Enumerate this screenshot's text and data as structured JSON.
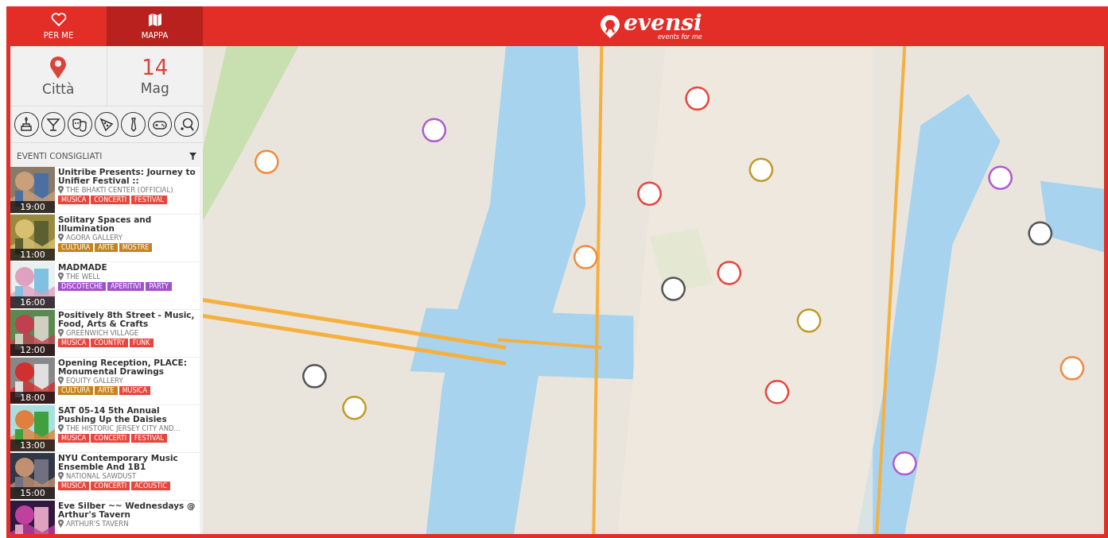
{
  "tabs": [
    {
      "label": "PER ME",
      "kind": "heart",
      "selected": false
    },
    {
      "label": "MAPPA",
      "kind": "map",
      "selected": true
    }
  ],
  "logo": {
    "name": "evensi",
    "tagline": "events for me"
  },
  "location": {
    "label": "Città"
  },
  "date": {
    "day": "14",
    "month": "Mag"
  },
  "categories": [
    {
      "kind": "cake"
    },
    {
      "kind": "cocktail"
    },
    {
      "kind": "masks"
    },
    {
      "kind": "pizza"
    },
    {
      "kind": "tie"
    },
    {
      "kind": "gamepad"
    },
    {
      "kind": "paddle"
    }
  ],
  "section": {
    "title": "EVENTI CONSIGLIATI"
  },
  "events": [
    {
      "title": "Unitribe Presents: Journey to Unifier Festival ::",
      "venue": "THE BHAKTI CENTER (OFFICIAL)",
      "time": "19:00",
      "tags": [
        {
          "label": "MUSICA",
          "color": "#e8453c"
        },
        {
          "label": "CONCERTI",
          "color": "#e8453c"
        },
        {
          "label": "FESTIVAL",
          "color": "#e8453c"
        }
      ]
    },
    {
      "title": "Solitary Spaces and Illumination",
      "venue": "AGORA GALLERY",
      "time": "11:00",
      "tags": [
        {
          "label": "CULTURA",
          "color": "#c8821c"
        },
        {
          "label": "ARTE",
          "color": "#c8821c"
        },
        {
          "label": "MOSTRE",
          "color": "#c8821c"
        }
      ]
    },
    {
      "title": "MADMADE",
      "venue": "THE WELL",
      "time": "16:00",
      "tags": [
        {
          "label": "DISCOTECHE",
          "color": "#a24fcc"
        },
        {
          "label": "APERITIVI",
          "color": "#a24fcc"
        },
        {
          "label": "PARTY",
          "color": "#a24fcc"
        }
      ]
    },
    {
      "title": "Positively 8th Street - Music, Food, Arts & Crafts",
      "venue": "GREENWICH VILLAGE",
      "time": "12:00",
      "tags": [
        {
          "label": "MUSICA",
          "color": "#e8453c"
        },
        {
          "label": "COUNTRY",
          "color": "#e8453c"
        },
        {
          "label": "FUNK",
          "color": "#e8453c"
        }
      ]
    },
    {
      "title": "Opening Reception, PLACE: Monumental Drawings",
      "venue": "EQUITY GALLERY",
      "time": "18:00",
      "tags": [
        {
          "label": "CULTURA",
          "color": "#c8821c"
        },
        {
          "label": "ARTE",
          "color": "#c8821c"
        },
        {
          "label": "MUSICA",
          "color": "#e8453c"
        }
      ]
    },
    {
      "title": "SAT 05-14 5th Annual Pushing Up the Daisies",
      "venue": "THE HISTORIC JERSEY CITY AND...",
      "time": "13:00",
      "tags": [
        {
          "label": "MUSICA",
          "color": "#e8453c"
        },
        {
          "label": "CONCERTI",
          "color": "#e8453c"
        },
        {
          "label": "FESTIVAL",
          "color": "#e8453c"
        }
      ]
    },
    {
      "title": "NYU Contemporary Music Ensemble And 1B1",
      "venue": "NATIONAL SAWDUST",
      "time": "15:00",
      "tags": [
        {
          "label": "MUSICA",
          "color": "#e8453c"
        },
        {
          "label": "CONCERTI",
          "color": "#e8453c"
        },
        {
          "label": "ACOUSTIC",
          "color": "#e8453c"
        }
      ]
    },
    {
      "title": "Eve Silber ~~ Wednesdays @ Arthur's Tavern",
      "venue": "ARTHUR'S TAVERN"
    }
  ]
}
